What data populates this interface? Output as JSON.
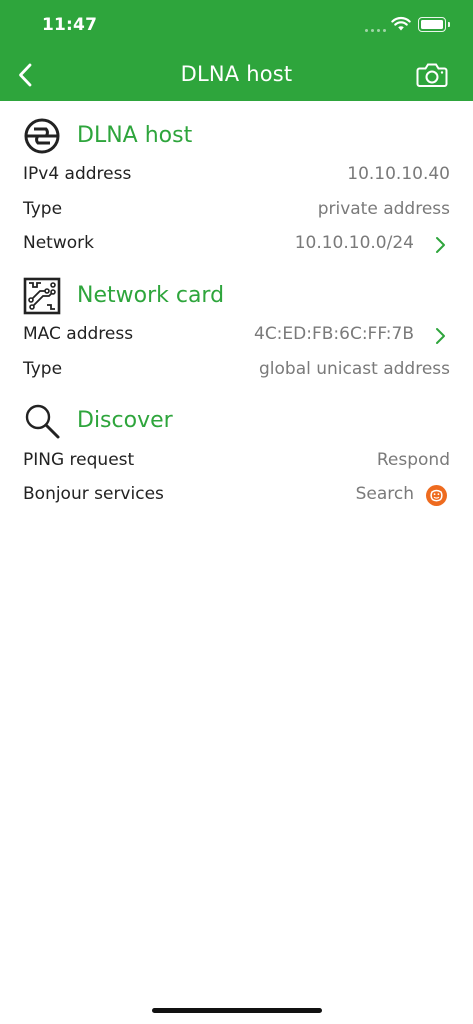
{
  "status_bar": {
    "time": "11:47"
  },
  "nav": {
    "title": "DLNA host"
  },
  "sections": {
    "host": {
      "title": "DLNA host",
      "rows": [
        {
          "label": "IPv4 address",
          "value": "10.10.10.40"
        },
        {
          "label": "Type",
          "value": "private address"
        },
        {
          "label": "Network",
          "value": "10.10.10.0/24"
        }
      ]
    },
    "card": {
      "title": "Network card",
      "rows": [
        {
          "label": "MAC address",
          "value": "4C:ED:FB:6C:FF:7B"
        },
        {
          "label": "Type",
          "value": "global unicast address"
        }
      ]
    },
    "discover": {
      "title": "Discover",
      "rows": [
        {
          "label": "PING request",
          "value": "Respond"
        },
        {
          "label": "Bonjour services",
          "value": "Search"
        }
      ]
    }
  },
  "icons": {
    "back": "chevron-left-icon",
    "camera": "camera-icon",
    "host": "dlna-logo-icon",
    "card": "network-card-icon",
    "discover": "magnifier-icon",
    "chevron": "chevron-right-icon",
    "bonjour": "bonjour-icon"
  },
  "colors": {
    "accent": "#2ea53c",
    "value_text": "#7a7a7a",
    "badge": "#ee6b1f"
  }
}
